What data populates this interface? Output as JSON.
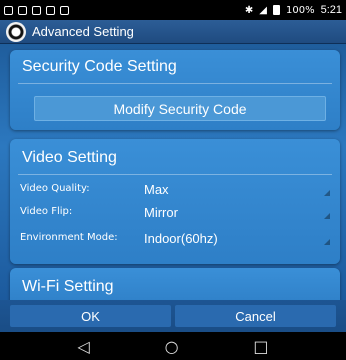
{
  "status_bar": {
    "battery": "100%",
    "time": "5:21"
  },
  "app_bar": {
    "title": "Advanced Setting"
  },
  "security_card": {
    "title": "Security Code Setting",
    "modify_button": "Modify Security Code"
  },
  "video_card": {
    "title": "Video Setting",
    "rows": [
      {
        "label": "Video Quality:",
        "value": "Max"
      },
      {
        "label": "Video Flip:",
        "value": "Mirror"
      },
      {
        "label": "Environment Mode:",
        "value": "Indoor(60hz)"
      }
    ]
  },
  "wifi_card": {
    "title": "Wi-Fi Setting"
  },
  "actions": {
    "ok": "OK",
    "cancel": "Cancel"
  },
  "nav": {
    "back_icon": "◁",
    "home_icon": "○",
    "recent_icon": "□"
  }
}
